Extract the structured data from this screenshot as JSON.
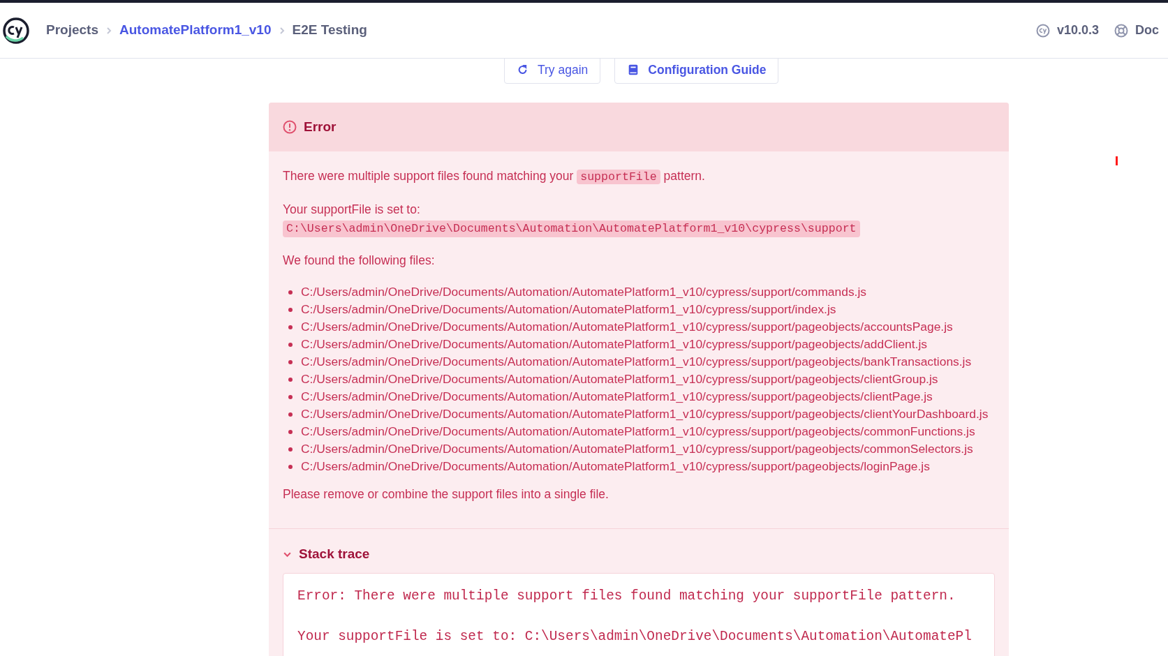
{
  "breadcrumbs": [
    {
      "label": "Projects",
      "kind": "plain"
    },
    {
      "label": "AutomatePlatform1_v10",
      "kind": "link"
    },
    {
      "label": "E2E Testing",
      "kind": "current"
    }
  ],
  "header_right": [
    {
      "label": "v10.0.3",
      "kind": "version"
    },
    {
      "label": "Doc",
      "kind": "docs"
    }
  ],
  "actions": [
    {
      "label": "Try again",
      "kind": "retry"
    },
    {
      "label": "Configuration Guide",
      "kind": "guide"
    }
  ],
  "error": {
    "title": "Error",
    "message": [
      {
        "text": "There were multiple support files found matching your ",
        "kind": "text"
      },
      {
        "text": "supportFile",
        "kind": "code"
      },
      {
        "text": " pattern.",
        "kind": "text"
      }
    ],
    "support_file_label": "Your supportFile is set to:",
    "support_file_path": "C:\\Users\\admin\\OneDrive\\Documents\\Automation\\AutomatePlatform1_v10\\cypress\\support",
    "files_label": "We found the following files:",
    "files": [
      "C:/Users/admin/OneDrive/Documents/Automation/AutomatePlatform1_v10/cypress/support/commands.js",
      "C:/Users/admin/OneDrive/Documents/Automation/AutomatePlatform1_v10/cypress/support/index.js",
      "C:/Users/admin/OneDrive/Documents/Automation/AutomatePlatform1_v10/cypress/support/pageobjects/accountsPage.js",
      "C:/Users/admin/OneDrive/Documents/Automation/AutomatePlatform1_v10/cypress/support/pageobjects/addClient.js",
      "C:/Users/admin/OneDrive/Documents/Automation/AutomatePlatform1_v10/cypress/support/pageobjects/bankTransactions.js",
      "C:/Users/admin/OneDrive/Documents/Automation/AutomatePlatform1_v10/cypress/support/pageobjects/clientGroup.js",
      "C:/Users/admin/OneDrive/Documents/Automation/AutomatePlatform1_v10/cypress/support/pageobjects/clientPage.js",
      "C:/Users/admin/OneDrive/Documents/Automation/AutomatePlatform1_v10/cypress/support/pageobjects/clientYourDashboard.js",
      "C:/Users/admin/OneDrive/Documents/Automation/AutomatePlatform1_v10/cypress/support/pageobjects/commonFunctions.js",
      "C:/Users/admin/OneDrive/Documents/Automation/AutomatePlatform1_v10/cypress/support/pageobjects/commonSelectors.js",
      "C:/Users/admin/OneDrive/Documents/Automation/AutomatePlatform1_v10/cypress/support/pageobjects/loginPage.js"
    ],
    "advice": "Please remove or combine the support files into a single file.",
    "stack_trace": {
      "title": "Stack trace",
      "expanded": true,
      "lines": [
        "Error: There were multiple support files found matching your supportFile pattern.",
        "Your supportFile is set to: C:\\Users\\admin\\OneDrive\\Documents\\Automation\\AutomatePl"
      ]
    }
  }
}
